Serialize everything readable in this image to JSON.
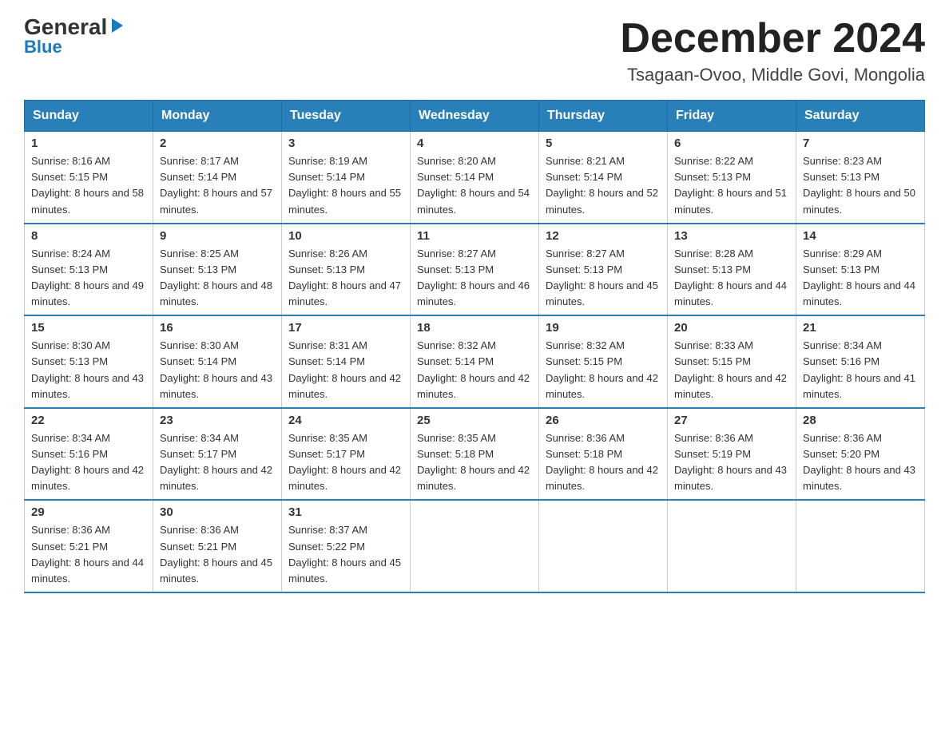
{
  "header": {
    "logo_line1": "General",
    "logo_line2": "Blue",
    "title": "December 2024",
    "subtitle": "Tsagaan-Ovoo, Middle Govi, Mongolia"
  },
  "days_of_week": [
    "Sunday",
    "Monday",
    "Tuesday",
    "Wednesday",
    "Thursday",
    "Friday",
    "Saturday"
  ],
  "weeks": [
    [
      {
        "day": "1",
        "sunrise": "8:16 AM",
        "sunset": "5:15 PM",
        "daylight": "8 hours and 58 minutes."
      },
      {
        "day": "2",
        "sunrise": "8:17 AM",
        "sunset": "5:14 PM",
        "daylight": "8 hours and 57 minutes."
      },
      {
        "day": "3",
        "sunrise": "8:19 AM",
        "sunset": "5:14 PM",
        "daylight": "8 hours and 55 minutes."
      },
      {
        "day": "4",
        "sunrise": "8:20 AM",
        "sunset": "5:14 PM",
        "daylight": "8 hours and 54 minutes."
      },
      {
        "day": "5",
        "sunrise": "8:21 AM",
        "sunset": "5:14 PM",
        "daylight": "8 hours and 52 minutes."
      },
      {
        "day": "6",
        "sunrise": "8:22 AM",
        "sunset": "5:13 PM",
        "daylight": "8 hours and 51 minutes."
      },
      {
        "day": "7",
        "sunrise": "8:23 AM",
        "sunset": "5:13 PM",
        "daylight": "8 hours and 50 minutes."
      }
    ],
    [
      {
        "day": "8",
        "sunrise": "8:24 AM",
        "sunset": "5:13 PM",
        "daylight": "8 hours and 49 minutes."
      },
      {
        "day": "9",
        "sunrise": "8:25 AM",
        "sunset": "5:13 PM",
        "daylight": "8 hours and 48 minutes."
      },
      {
        "day": "10",
        "sunrise": "8:26 AM",
        "sunset": "5:13 PM",
        "daylight": "8 hours and 47 minutes."
      },
      {
        "day": "11",
        "sunrise": "8:27 AM",
        "sunset": "5:13 PM",
        "daylight": "8 hours and 46 minutes."
      },
      {
        "day": "12",
        "sunrise": "8:27 AM",
        "sunset": "5:13 PM",
        "daylight": "8 hours and 45 minutes."
      },
      {
        "day": "13",
        "sunrise": "8:28 AM",
        "sunset": "5:13 PM",
        "daylight": "8 hours and 44 minutes."
      },
      {
        "day": "14",
        "sunrise": "8:29 AM",
        "sunset": "5:13 PM",
        "daylight": "8 hours and 44 minutes."
      }
    ],
    [
      {
        "day": "15",
        "sunrise": "8:30 AM",
        "sunset": "5:13 PM",
        "daylight": "8 hours and 43 minutes."
      },
      {
        "day": "16",
        "sunrise": "8:30 AM",
        "sunset": "5:14 PM",
        "daylight": "8 hours and 43 minutes."
      },
      {
        "day": "17",
        "sunrise": "8:31 AM",
        "sunset": "5:14 PM",
        "daylight": "8 hours and 42 minutes."
      },
      {
        "day": "18",
        "sunrise": "8:32 AM",
        "sunset": "5:14 PM",
        "daylight": "8 hours and 42 minutes."
      },
      {
        "day": "19",
        "sunrise": "8:32 AM",
        "sunset": "5:15 PM",
        "daylight": "8 hours and 42 minutes."
      },
      {
        "day": "20",
        "sunrise": "8:33 AM",
        "sunset": "5:15 PM",
        "daylight": "8 hours and 42 minutes."
      },
      {
        "day": "21",
        "sunrise": "8:34 AM",
        "sunset": "5:16 PM",
        "daylight": "8 hours and 41 minutes."
      }
    ],
    [
      {
        "day": "22",
        "sunrise": "8:34 AM",
        "sunset": "5:16 PM",
        "daylight": "8 hours and 42 minutes."
      },
      {
        "day": "23",
        "sunrise": "8:34 AM",
        "sunset": "5:17 PM",
        "daylight": "8 hours and 42 minutes."
      },
      {
        "day": "24",
        "sunrise": "8:35 AM",
        "sunset": "5:17 PM",
        "daylight": "8 hours and 42 minutes."
      },
      {
        "day": "25",
        "sunrise": "8:35 AM",
        "sunset": "5:18 PM",
        "daylight": "8 hours and 42 minutes."
      },
      {
        "day": "26",
        "sunrise": "8:36 AM",
        "sunset": "5:18 PM",
        "daylight": "8 hours and 42 minutes."
      },
      {
        "day": "27",
        "sunrise": "8:36 AM",
        "sunset": "5:19 PM",
        "daylight": "8 hours and 43 minutes."
      },
      {
        "day": "28",
        "sunrise": "8:36 AM",
        "sunset": "5:20 PM",
        "daylight": "8 hours and 43 minutes."
      }
    ],
    [
      {
        "day": "29",
        "sunrise": "8:36 AM",
        "sunset": "5:21 PM",
        "daylight": "8 hours and 44 minutes."
      },
      {
        "day": "30",
        "sunrise": "8:36 AM",
        "sunset": "5:21 PM",
        "daylight": "8 hours and 45 minutes."
      },
      {
        "day": "31",
        "sunrise": "8:37 AM",
        "sunset": "5:22 PM",
        "daylight": "8 hours and 45 minutes."
      },
      null,
      null,
      null,
      null
    ]
  ]
}
